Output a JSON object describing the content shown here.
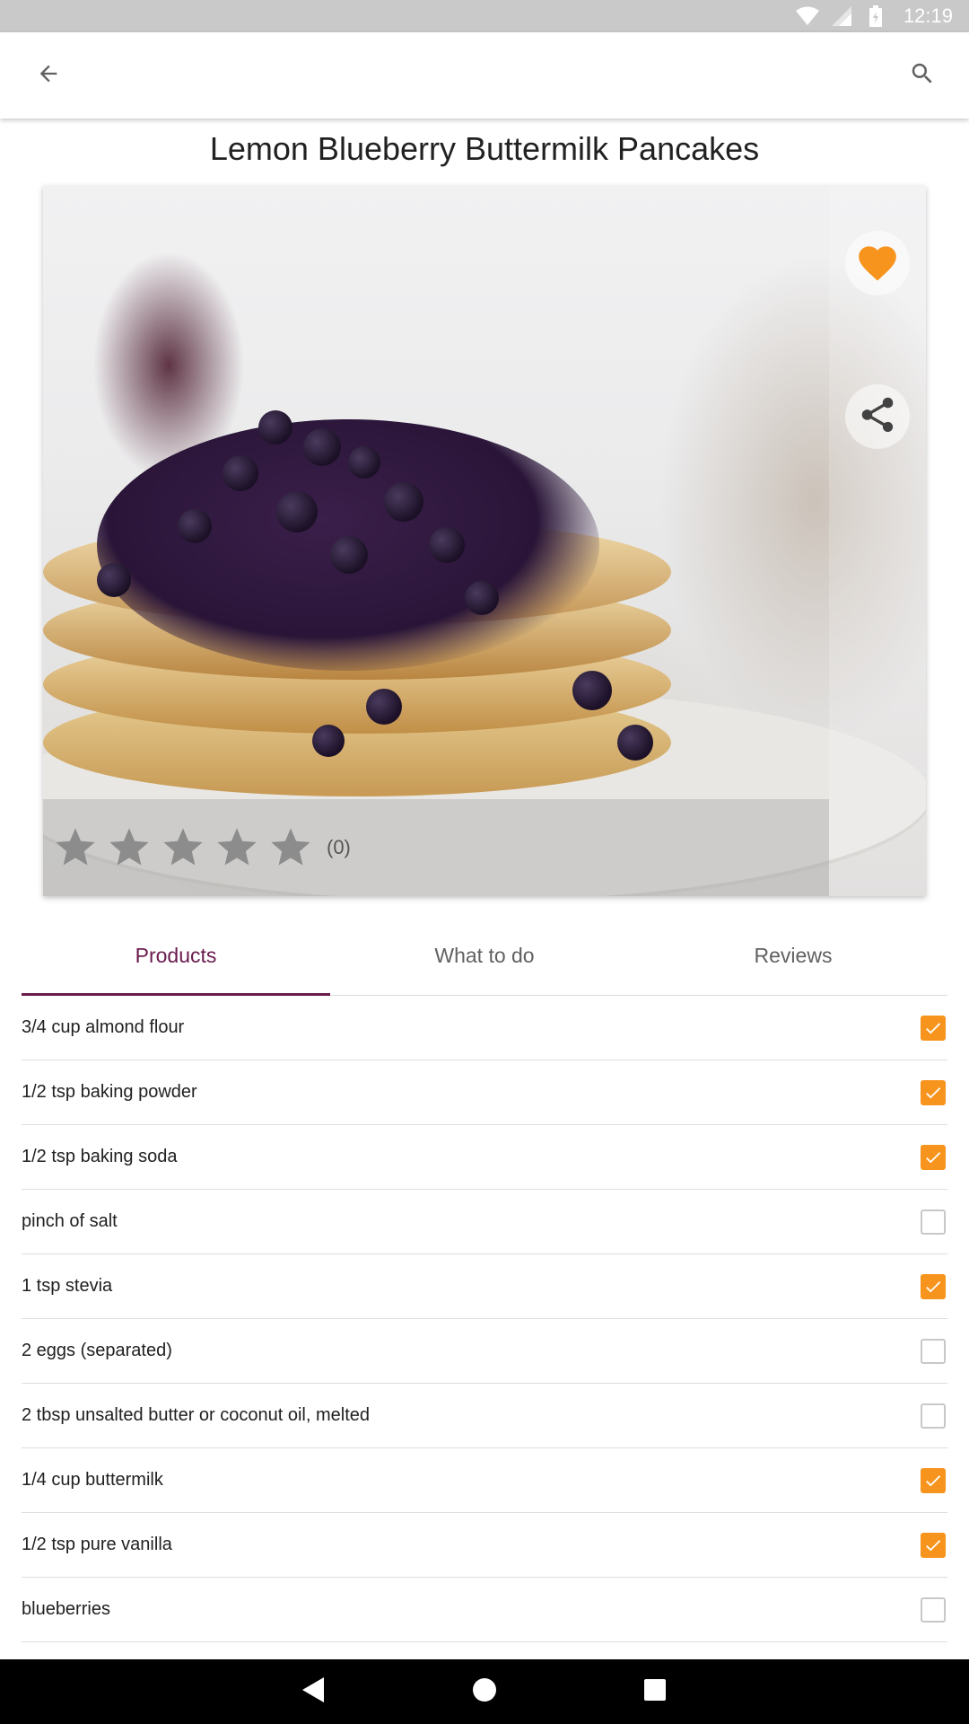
{
  "status_bar": {
    "time": "12:19",
    "icons": [
      "wifi-icon",
      "cell-signal-icon",
      "battery-icon"
    ]
  },
  "app_bar": {
    "back_icon": "arrow-left-icon",
    "search_icon": "search-icon"
  },
  "recipe": {
    "title": "Lemon Blueberry Buttermilk Pancakes",
    "favorite_icon": "heart-icon",
    "share_icon": "share-icon",
    "rating": {
      "stars_filled": 0,
      "stars_total": 5,
      "count_label": "(0)"
    }
  },
  "tabs": [
    {
      "label": "Products",
      "active": true
    },
    {
      "label": "What to do",
      "active": false
    },
    {
      "label": "Reviews",
      "active": false
    }
  ],
  "ingredients": [
    {
      "label": "3/4 cup almond flour",
      "checked": true
    },
    {
      "label": "1/2 tsp baking powder",
      "checked": true
    },
    {
      "label": "1/2 tsp baking soda",
      "checked": true
    },
    {
      "label": "pinch of salt",
      "checked": false
    },
    {
      "label": "1 tsp stevia",
      "checked": true
    },
    {
      "label": "2 eggs (separated)",
      "checked": false
    },
    {
      "label": "2 tbsp unsalted butter or coconut oil, melted",
      "checked": false
    },
    {
      "label": "1/4 cup buttermilk",
      "checked": true
    },
    {
      "label": "1/2 tsp pure vanilla",
      "checked": true
    },
    {
      "label": "blueberries",
      "checked": false
    }
  ],
  "colors": {
    "accent": "#6a1b4d",
    "checkbox_checked": "#f7941d",
    "favorite": "#f7941d"
  },
  "nav_bar": {
    "back_icon": "nav-back-icon",
    "home_icon": "nav-home-icon",
    "recents_icon": "nav-recents-icon"
  }
}
